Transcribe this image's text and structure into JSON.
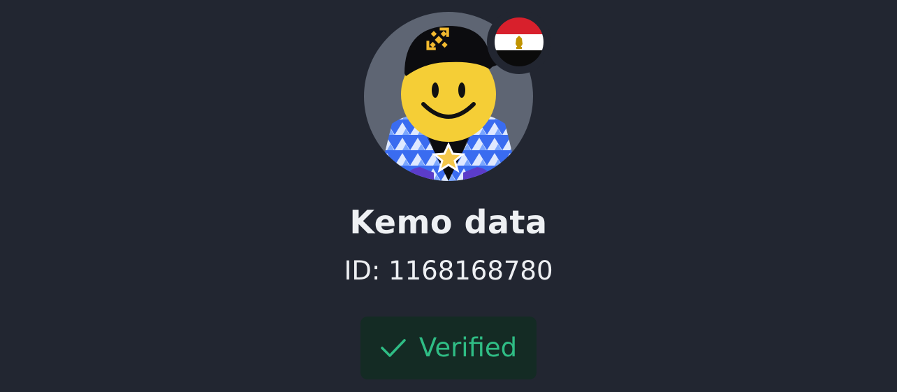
{
  "profile": {
    "display_name": "Kemo data",
    "user_id_text": "ID: 1168168780",
    "country_flag": "egypt-flag-icon",
    "avatar": "smiley-face-avatar-with-cap"
  },
  "verification": {
    "label": "Verified",
    "icon": "check-icon"
  },
  "colors": {
    "background": "#222631",
    "text": "#eef0f3",
    "verified_text": "#2fbd85",
    "verified_bg": "#142b24",
    "avatar_bg": "#5e6573",
    "smiley_yellow": "#f5ce36"
  }
}
